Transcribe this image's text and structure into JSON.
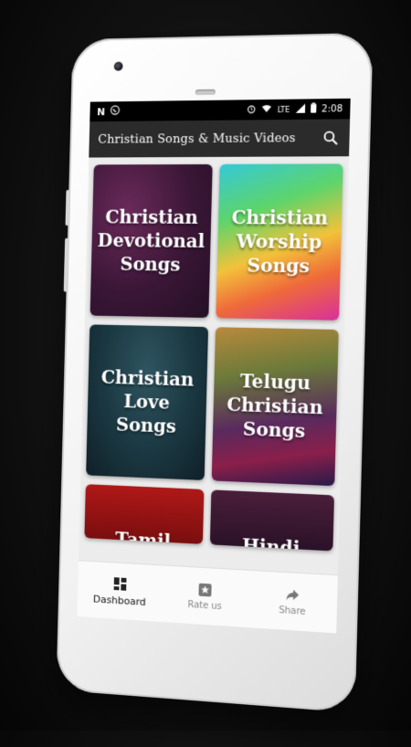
{
  "status_bar": {
    "left_icons": [
      "n-notification-icon",
      "whatsapp-icon"
    ],
    "network": "LTE",
    "time": "2:08"
  },
  "app_bar": {
    "title": "Christian Songs & Music Videos",
    "search_icon": "search-icon"
  },
  "categories": [
    {
      "label": "Christian Devotional Songs"
    },
    {
      "label": "Christian Worship Songs"
    },
    {
      "label": "Christian Love Songs"
    },
    {
      "label": "Telugu Christian Songs"
    },
    {
      "label": "Tamil"
    },
    {
      "label": "Hindi"
    }
  ],
  "bottom_nav": [
    {
      "label": "Dashboard",
      "icon": "dashboard-icon",
      "active": true
    },
    {
      "label": "Rate us",
      "icon": "star-icon",
      "active": false
    },
    {
      "label": "Share",
      "icon": "share-icon",
      "active": false
    }
  ],
  "colors": {
    "app_bar": "#2b2b2b",
    "status_bar": "#000000",
    "screen_bg": "#ececec"
  }
}
